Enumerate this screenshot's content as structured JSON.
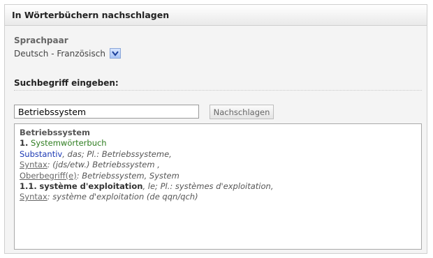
{
  "panel": {
    "title": "In Wörterbüchern nachschlagen"
  },
  "language_pair": {
    "label": "Sprachpaar",
    "selected": "Deutsch - Französisch",
    "icon": "chevron-down-icon"
  },
  "search": {
    "label": "Suchbegriff eingeben:",
    "value": "Betriebssystem",
    "button_label": "Nachschlagen"
  },
  "results": {
    "headword": "Betriebssystem",
    "section_number": "1.",
    "section_title": "Systemwörterbuch",
    "pos_link": "Substantiv",
    "pos_detail": ", das; Pl.: Betriebssysteme,",
    "syntax_label": "Syntax",
    "syntax_text": ": (jds/etw.) Betriebssystem ,",
    "hypernym_label": "Oberbegriff(e)",
    "hypernym_text": ": Betriebssystem, System",
    "sub_number": "1.1.",
    "translation": "système d'exploitation",
    "translation_detail": ", le; Pl.: systèmes d'exploitation,",
    "syntax2_label": "Syntax",
    "syntax2_text": ": système d'exploitation (de qqn/qch)"
  },
  "colors": {
    "green": "#2e7d1f",
    "blue": "#1b38b4",
    "select_arrow_bg": "#a9c4f5"
  }
}
